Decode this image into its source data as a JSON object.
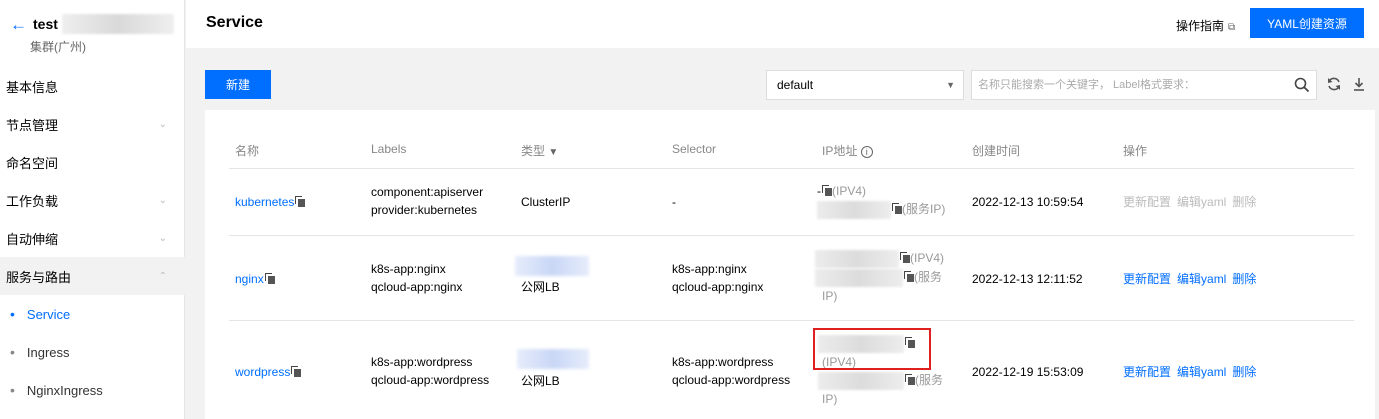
{
  "sidebar": {
    "cluster_name": "test",
    "cluster_region": "集群(广州)",
    "menu": {
      "basic": "基本信息",
      "nodes": "节点管理",
      "namespace": "命名空间",
      "workloads": "工作负载",
      "autoscale": "自动伸缩",
      "services": "服务与路由"
    },
    "sub": {
      "service": "Service",
      "ingress": "Ingress",
      "nginx_ingress": "NginxIngress"
    }
  },
  "header": {
    "title": "Service",
    "guide": "操作指南",
    "yaml_button": "YAML创建资源"
  },
  "toolbar": {
    "new_button": "新建",
    "namespace": "default",
    "search_placeholder": "名称只能搜索一个关键字， Label格式要求："
  },
  "table": {
    "headers": {
      "name": "名称",
      "labels": "Labels",
      "type": "类型",
      "selector": "Selector",
      "ip": "IP地址",
      "created": "创建时间",
      "ops": "操作"
    },
    "rows": [
      {
        "name": "kubernetes",
        "labels": [
          "component:apiserver",
          "provider:kubernetes"
        ],
        "type": "ClusterIP",
        "selector": [
          "-"
        ],
        "ip_dash": "-",
        "ip_v4": "(IPV4)",
        "ip_service": "(服务IP)",
        "created": "2022-12-13 10:59:54",
        "ops": [
          "更新配置",
          "编辑yaml",
          "删除"
        ]
      },
      {
        "name": "nginx",
        "labels": [
          "k8s-app:nginx",
          "qcloud-app:nginx"
        ],
        "type": "公网LB",
        "selector": [
          "k8s-app:nginx",
          "qcloud-app:nginx"
        ],
        "ip_v4": "(IPV4)",
        "ip_service_a": "(服务",
        "ip_service_b": "IP)",
        "created": "2022-12-13 12:11:52",
        "ops": [
          "更新配置",
          "编辑yaml",
          "删除"
        ]
      },
      {
        "name": "wordpress",
        "labels": [
          "k8s-app:wordpress",
          "qcloud-app:wordpress"
        ],
        "type": "公网LB",
        "selector": [
          "k8s-app:wordpress",
          "qcloud-app:wordpress"
        ],
        "ip_v4": "(IPV4)",
        "ip_service_a": "(服务",
        "ip_service_b": "IP)",
        "created": "2022-12-19 15:53:09",
        "ops": [
          "更新配置",
          "编辑yaml",
          "删除"
        ]
      }
    ]
  },
  "colors": {
    "primary": "#006eff",
    "highlight_box": "#e02020"
  }
}
